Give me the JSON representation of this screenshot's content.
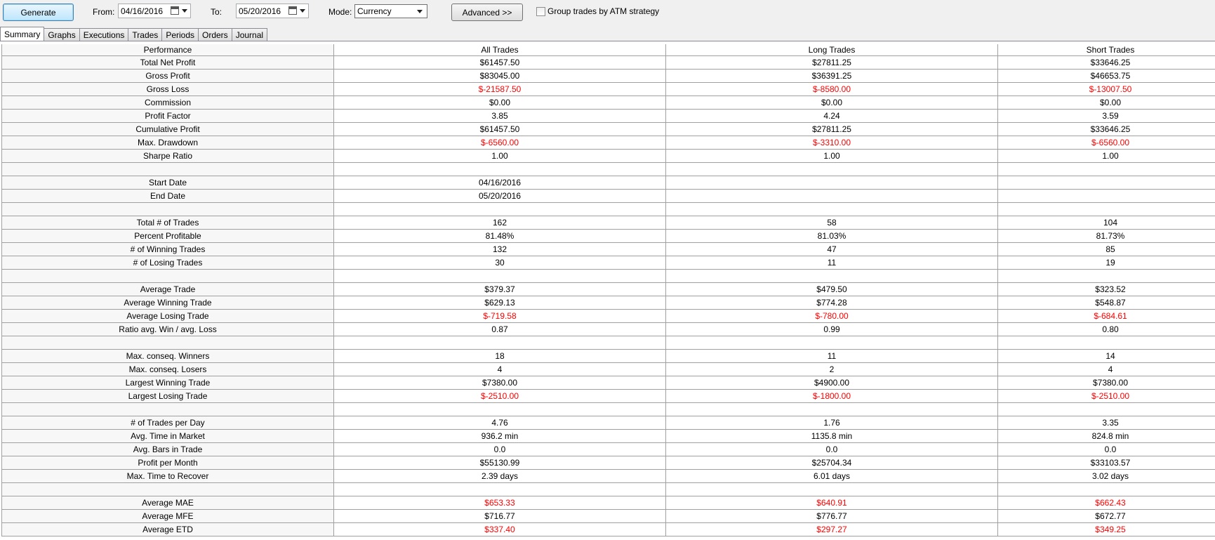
{
  "toolbar": {
    "generate_label": "Generate",
    "from_label": "From:",
    "from_date": "04/16/2016",
    "to_label": "To:",
    "to_date": "05/20/2016",
    "mode_label": "Mode:",
    "mode_value": "Currency",
    "advanced_label": "Advanced >>",
    "group_checkbox_label": "Group trades by ATM strategy"
  },
  "tabs": [
    {
      "label": "Summary",
      "active": true
    },
    {
      "label": "Graphs"
    },
    {
      "label": "Executions"
    },
    {
      "label": "Trades"
    },
    {
      "label": "Periods"
    },
    {
      "label": "Orders"
    },
    {
      "label": "Journal"
    }
  ],
  "table": {
    "headers": [
      "Performance",
      "All Trades",
      "Long Trades",
      "Short Trades"
    ],
    "rows": [
      [
        "Total Net Profit",
        "$61457.50",
        "$27811.25",
        "$33646.25"
      ],
      [
        "Gross Profit",
        "$83045.00",
        "$36391.25",
        "$46653.75"
      ],
      [
        "Gross Loss",
        "$-21587.50",
        "$-8580.00",
        "$-13007.50"
      ],
      [
        "Commission",
        "$0.00",
        "$0.00",
        "$0.00"
      ],
      [
        "Profit Factor",
        "3.85",
        "4.24",
        "3.59"
      ],
      [
        "Cumulative Profit",
        "$61457.50",
        "$27811.25",
        "$33646.25"
      ],
      [
        "Max. Drawdown",
        "$-6560.00",
        "$-3310.00",
        "$-6560.00"
      ],
      [
        "Sharpe Ratio",
        "1.00",
        "1.00",
        "1.00"
      ],
      [
        "",
        "",
        "",
        ""
      ],
      [
        "Start Date",
        "04/16/2016",
        "",
        ""
      ],
      [
        "End Date",
        "05/20/2016",
        "",
        ""
      ],
      [
        "",
        "",
        "",
        ""
      ],
      [
        "Total # of Trades",
        "162",
        "58",
        "104"
      ],
      [
        "Percent Profitable",
        "81.48%",
        "81.03%",
        "81.73%"
      ],
      [
        "# of Winning Trades",
        "132",
        "47",
        "85"
      ],
      [
        "# of Losing Trades",
        "30",
        "11",
        "19"
      ],
      [
        "",
        "",
        "",
        ""
      ],
      [
        "Average Trade",
        "$379.37",
        "$479.50",
        "$323.52"
      ],
      [
        "Average Winning Trade",
        "$629.13",
        "$774.28",
        "$548.87"
      ],
      [
        "Average Losing Trade",
        "$-719.58",
        "$-780.00",
        "$-684.61"
      ],
      [
        "Ratio avg. Win / avg. Loss",
        "0.87",
        "0.99",
        "0.80"
      ],
      [
        "",
        "",
        "",
        ""
      ],
      [
        "Max. conseq. Winners",
        "18",
        "11",
        "14"
      ],
      [
        "Max. conseq. Losers",
        "4",
        "2",
        "4"
      ],
      [
        "Largest Winning Trade",
        "$7380.00",
        "$4900.00",
        "$7380.00"
      ],
      [
        "Largest Losing Trade",
        "$-2510.00",
        "$-1800.00",
        "$-2510.00"
      ],
      [
        "",
        "",
        "",
        ""
      ],
      [
        "# of Trades per Day",
        "4.76",
        "1.76",
        "3.35"
      ],
      [
        "Avg. Time in Market",
        "936.2 min",
        "1135.8 min",
        "824.8 min"
      ],
      [
        "Avg. Bars in Trade",
        "0.0",
        "0.0",
        "0.0"
      ],
      [
        "Profit per Month",
        "$55130.99",
        "$25704.34",
        "$33103.57"
      ],
      [
        "Max. Time to Recover",
        "2.39 days",
        "6.01 days",
        "3.02 days"
      ],
      [
        "",
        "",
        "",
        ""
      ],
      [
        "Average MAE",
        "$653.33",
        "$640.91",
        "$662.43"
      ],
      [
        "Average MFE",
        "$716.77",
        "$776.77",
        "$672.77"
      ],
      [
        "Average ETD",
        "$337.40",
        "$297.27",
        "$349.25"
      ]
    ],
    "red_rows": [
      2,
      6,
      19,
      25,
      33,
      35
    ]
  },
  "colors": {
    "negative": "#ff0000",
    "accent_button": "#3c7fb1"
  }
}
